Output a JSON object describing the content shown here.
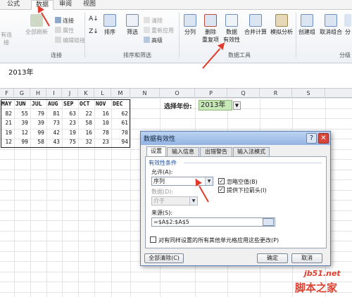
{
  "ribbon": {
    "tabs": [
      {
        "label": "公式",
        "left": 0
      },
      {
        "label": "数据",
        "left": 0
      },
      {
        "label": "审阅",
        "left": 0
      },
      {
        "label": "视图",
        "left": 0
      }
    ],
    "connections": {
      "partial_label": "有连接",
      "refresh_all": "全部刷新",
      "connections": "连接",
      "properties": "属性",
      "edit_links": "编辑链接",
      "group_label": "连接"
    },
    "sort_filter": {
      "sort": "排序",
      "filter": "筛选",
      "clear": "清除",
      "reapply": "重新应用",
      "advanced": "高级",
      "group_label": "排序和筛选"
    },
    "data_tools": {
      "text_to_columns": "分列",
      "remove_duplicates_line1": "删除",
      "remove_duplicates_line2": "重复项",
      "data_validation_line1": "数据",
      "data_validation_line2": "有效性",
      "consolidate": "合并计算",
      "what_if": "模拟分析",
      "group_label": "数据工具"
    },
    "outline": {
      "group": "创建组",
      "ungroup": "取消组合",
      "subtotal": "分",
      "group_label": "分级"
    }
  },
  "formula_bar": {
    "value": "2013年"
  },
  "grid": {
    "columns": [
      "F",
      "G",
      "H",
      "I",
      "J",
      "K",
      "L",
      "M",
      "N",
      "O",
      "P",
      "Q",
      "R",
      "S"
    ],
    "table_headers": [
      "MAY",
      "JUN",
      "JUL",
      "AUG",
      "SEP",
      "OCT",
      "NOV",
      "DEC"
    ],
    "rows": [
      [
        "82",
        "55",
        "79",
        "81",
        "63",
        "22",
        "16",
        "62"
      ],
      [
        "21",
        "39",
        "39",
        "73",
        "23",
        "58",
        "10",
        "61"
      ],
      [
        "19",
        "12",
        "99",
        "42",
        "19",
        "16",
        "78",
        "70"
      ],
      [
        "12",
        "99",
        "58",
        "43",
        "75",
        "32",
        "23",
        "94"
      ]
    ],
    "select_year_label": "选择年份:",
    "select_year_value": "2013年"
  },
  "dialog": {
    "title": "数据有效性",
    "tabs": [
      "设置",
      "输入信息",
      "出错警告",
      "输入法模式"
    ],
    "criteria_title": "有效性条件",
    "allow_label": "允许(A):",
    "allow_value": "序列",
    "data_label": "数据(D):",
    "data_value": "介于",
    "ignore_blank": "忽略空值(B)",
    "in_cell_dropdown": "提供下拉箭头(I)",
    "source_label": "来源(S):",
    "source_value": "=$A$2:$A$5",
    "apply_all": "对有同样设置的所有其他单元格应用这些更改(P)",
    "clear_all": "全部清除(C)",
    "ok": "确定",
    "cancel": "取消"
  },
  "watermark": {
    "line1": "jb51.net",
    "line2": "脚本之家"
  },
  "colors": {
    "accent_red": "#e23b2c",
    "year_cell": "#c9e8b8",
    "dialog_title": "#93b4e2"
  }
}
